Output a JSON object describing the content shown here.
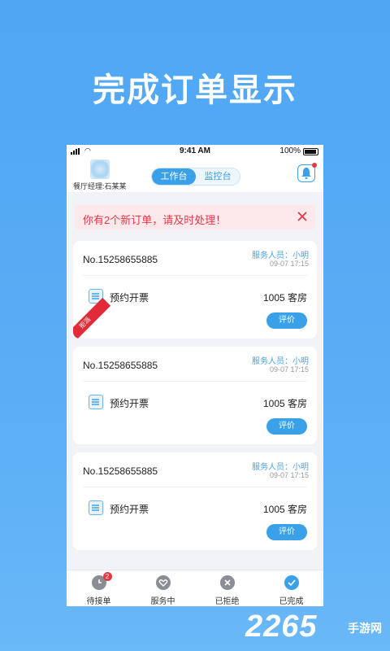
{
  "headline": "完成订单显示",
  "status_bar": {
    "time": "9:41 AM",
    "battery": "100%"
  },
  "header": {
    "manager": "餐厅经理:石某某",
    "tabs": [
      {
        "label": "工作台",
        "active": true
      },
      {
        "label": "监控台",
        "active": false
      }
    ],
    "bell_icon": "bell-icon"
  },
  "alert": {
    "message": "你有2个新订单，请及时处理！"
  },
  "orders": [
    {
      "number": "No.15258655885",
      "staff": "服务人员：小明",
      "time": "09-07 17:15",
      "service": "预约开票",
      "room": "1005 客房",
      "action": "评价",
      "ribbon": "拒派"
    },
    {
      "number": "No.15258655885",
      "staff": "服务人员：小明",
      "time": "09-07 17:15",
      "service": "预约开票",
      "room": "1005 客房",
      "action": "评价"
    },
    {
      "number": "No.15258655885",
      "staff": "服务人员：小明",
      "time": "09-07 17:15",
      "service": "预约开票",
      "room": "1005 客房",
      "action": "评价"
    }
  ],
  "tabbar": [
    {
      "label": "待接单",
      "icon": "clock-icon",
      "badge": "2"
    },
    {
      "label": "服务中",
      "icon": "heart-icon"
    },
    {
      "label": "已拒绝",
      "icon": "close-circle-icon"
    },
    {
      "label": "已完成",
      "icon": "check-circle-icon",
      "active": true
    }
  ],
  "watermark": {
    "number": "2265",
    "site": "手游网"
  },
  "colors": {
    "accent": "#3aa0e8",
    "alert": "#e23846",
    "background": "#55aaf4"
  }
}
